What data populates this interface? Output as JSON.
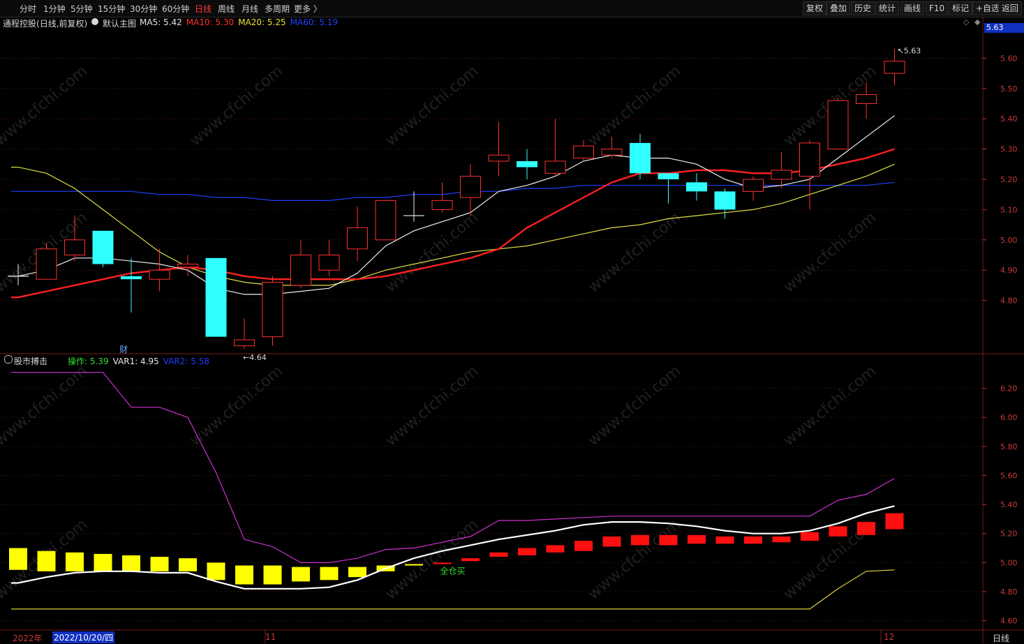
{
  "toolbar": {
    "periods": [
      "分时",
      "1分钟",
      "5分钟",
      "15分钟",
      "30分钟",
      "60分钟",
      "日线",
      "周线",
      "月线",
      "多周期",
      "更多 〉"
    ],
    "active_period": "日线",
    "buttons": [
      "复权",
      "叠加",
      "历史",
      "统计",
      "画线",
      "F10",
      "标记",
      "+自选",
      "返回"
    ]
  },
  "main_panel": {
    "stock_name": "通程控股",
    "mode": "(日线,前复权)",
    "template": "默认主图",
    "ma": [
      {
        "label": "MA5: 5.42",
        "color": "#e8e8e8"
      },
      {
        "label": "MA10: 5.30",
        "color": "#ff3030"
      },
      {
        "label": "MA20: 5.25",
        "color": "#f0e040"
      },
      {
        "label": "MA60: 5.19",
        "color": "#2040ff"
      }
    ],
    "price_box": "5.63",
    "max_label": "5.63",
    "min_label": "4.64",
    "finance_marker": "财",
    "y_ticks": [
      "5.60",
      "5.50",
      "5.40",
      "5.30",
      "5.20",
      "5.10",
      "5.00",
      "4.90",
      "4.80"
    ]
  },
  "sub_panel": {
    "name": "股市搏击",
    "ind": [
      {
        "label": "操作: 5.39",
        "color": "#30e030"
      },
      {
        "label": "VAR1: 4.95",
        "color": "#e8e8e8"
      },
      {
        "label": "VAR2: 5.58",
        "color": "#2040ff"
      }
    ],
    "signal_label": "全仓买",
    "y_ticks": [
      "6.20",
      "6.00",
      "5.80",
      "5.60",
      "5.40",
      "5.20",
      "5.00",
      "4.80",
      "4.60"
    ]
  },
  "bottom_axis": {
    "labels": [
      "2022年",
      "2022/10/20/四",
      "11",
      "12"
    ],
    "period_label": "日线"
  },
  "watermark": "www.cfchi.com",
  "chart_data": {
    "type": "candlestick",
    "main": {
      "candles": [
        {
          "o": 4.88,
          "h": 4.92,
          "l": 4.85,
          "c": 4.88
        },
        {
          "o": 4.87,
          "h": 4.99,
          "l": 4.87,
          "c": 4.97
        },
        {
          "o": 4.95,
          "h": 5.08,
          "l": 4.93,
          "c": 5.0
        },
        {
          "o": 5.03,
          "h": 5.03,
          "l": 4.91,
          "c": 4.92
        },
        {
          "o": 4.88,
          "h": 4.94,
          "l": 4.76,
          "c": 4.87
        },
        {
          "o": 4.87,
          "h": 4.97,
          "l": 4.83,
          "c": 4.9
        },
        {
          "o": 4.91,
          "h": 4.95,
          "l": 4.88,
          "c": 4.92
        },
        {
          "o": 4.94,
          "h": 4.94,
          "l": 4.68,
          "c": 4.68
        },
        {
          "o": 4.65,
          "h": 4.74,
          "l": 4.64,
          "c": 4.67
        },
        {
          "o": 4.68,
          "h": 4.88,
          "l": 4.65,
          "c": 4.86
        },
        {
          "o": 4.85,
          "h": 5.0,
          "l": 4.84,
          "c": 4.95
        },
        {
          "o": 4.9,
          "h": 5.0,
          "l": 4.88,
          "c": 4.95
        },
        {
          "o": 4.97,
          "h": 5.11,
          "l": 4.93,
          "c": 5.04
        },
        {
          "o": 5.0,
          "h": 5.13,
          "l": 5.0,
          "c": 5.13
        },
        {
          "o": 5.08,
          "h": 5.16,
          "l": 5.06,
          "c": 5.08
        },
        {
          "o": 5.1,
          "h": 5.19,
          "l": 5.09,
          "c": 5.13
        },
        {
          "o": 5.14,
          "h": 5.25,
          "l": 5.08,
          "c": 5.21
        },
        {
          "o": 5.26,
          "h": 5.39,
          "l": 5.21,
          "c": 5.28
        },
        {
          "o": 5.26,
          "h": 5.3,
          "l": 5.2,
          "c": 5.24
        },
        {
          "o": 5.22,
          "h": 5.4,
          "l": 5.21,
          "c": 5.26
        },
        {
          "o": 5.27,
          "h": 5.33,
          "l": 5.26,
          "c": 5.31
        },
        {
          "o": 5.28,
          "h": 5.34,
          "l": 5.27,
          "c": 5.3
        },
        {
          "o": 5.32,
          "h": 5.35,
          "l": 5.2,
          "c": 5.22
        },
        {
          "o": 5.22,
          "h": 5.22,
          "l": 5.12,
          "c": 5.2
        },
        {
          "o": 5.19,
          "h": 5.22,
          "l": 5.13,
          "c": 5.16
        },
        {
          "o": 5.16,
          "h": 5.17,
          "l": 5.07,
          "c": 5.1
        },
        {
          "o": 5.16,
          "h": 5.21,
          "l": 5.13,
          "c": 5.2
        },
        {
          "o": 5.2,
          "h": 5.29,
          "l": 5.17,
          "c": 5.23
        },
        {
          "o": 5.21,
          "h": 5.33,
          "l": 5.1,
          "c": 5.32
        },
        {
          "o": 5.3,
          "h": 5.47,
          "l": 5.3,
          "c": 5.46
        },
        {
          "o": 5.45,
          "h": 5.52,
          "l": 5.4,
          "c": 5.48
        },
        {
          "o": 5.55,
          "h": 5.63,
          "l": 5.51,
          "c": 5.59
        }
      ],
      "ma5": [
        4.88,
        4.9,
        4.94,
        4.94,
        4.93,
        4.92,
        4.9,
        4.84,
        4.82,
        4.82,
        4.83,
        4.84,
        4.89,
        4.98,
        5.03,
        5.06,
        5.09,
        5.16,
        5.18,
        5.21,
        5.26,
        5.28,
        5.27,
        5.27,
        5.25,
        5.2,
        5.17,
        5.18,
        5.2,
        5.27,
        5.34,
        5.41
      ],
      "ma10": [
        4.81,
        4.83,
        4.85,
        4.87,
        4.89,
        4.9,
        4.91,
        4.9,
        4.88,
        4.87,
        4.87,
        4.87,
        4.87,
        4.88,
        4.9,
        4.92,
        4.94,
        4.97,
        5.04,
        5.09,
        5.14,
        5.19,
        5.22,
        5.22,
        5.23,
        5.23,
        5.22,
        5.22,
        5.23,
        5.25,
        5.27,
        5.3
      ],
      "ma20": [
        5.24,
        5.22,
        5.17,
        5.1,
        5.03,
        4.96,
        4.91,
        4.88,
        4.86,
        4.85,
        4.85,
        4.85,
        4.87,
        4.9,
        4.92,
        4.94,
        4.96,
        4.97,
        4.98,
        5.0,
        5.02,
        5.04,
        5.05,
        5.07,
        5.08,
        5.09,
        5.1,
        5.12,
        5.15,
        5.18,
        5.21,
        5.25
      ],
      "ma60": [
        5.16,
        5.16,
        5.16,
        5.16,
        5.16,
        5.15,
        5.15,
        5.14,
        5.14,
        5.13,
        5.13,
        5.13,
        5.14,
        5.14,
        5.15,
        5.15,
        5.16,
        5.16,
        5.17,
        5.17,
        5.18,
        5.18,
        5.18,
        5.18,
        5.18,
        5.18,
        5.18,
        5.18,
        5.18,
        5.18,
        5.18,
        5.19
      ]
    },
    "sub": {
      "bars": [
        {
          "top": 5.1,
          "bot": 4.95
        },
        {
          "top": 5.08,
          "bot": 4.94
        },
        {
          "top": 5.07,
          "bot": 4.94
        },
        {
          "top": 5.06,
          "bot": 4.94
        },
        {
          "top": 5.05,
          "bot": 4.94
        },
        {
          "top": 5.04,
          "bot": 4.94
        },
        {
          "top": 5.03,
          "bot": 4.94
        },
        {
          "top": 5.0,
          "bot": 4.88
        },
        {
          "top": 4.98,
          "bot": 4.85
        },
        {
          "top": 4.98,
          "bot": 4.85
        },
        {
          "top": 4.97,
          "bot": 4.87
        },
        {
          "top": 4.97,
          "bot": 4.88
        },
        {
          "top": 4.97,
          "bot": 4.9
        },
        {
          "top": 4.98,
          "bot": 4.94
        },
        {
          "top": 4.99,
          "bot": 4.98
        },
        {
          "top": 5.0,
          "bot": 4.99
        },
        {
          "top": 5.03,
          "bot": 5.01
        },
        {
          "top": 5.07,
          "bot": 5.04
        },
        {
          "top": 5.1,
          "bot": 5.05
        },
        {
          "top": 5.12,
          "bot": 5.07
        },
        {
          "top": 5.15,
          "bot": 5.08
        },
        {
          "top": 5.18,
          "bot": 5.11
        },
        {
          "top": 5.19,
          "bot": 5.12
        },
        {
          "top": 5.19,
          "bot": 5.12
        },
        {
          "top": 5.19,
          "bot": 5.13
        },
        {
          "top": 5.18,
          "bot": 5.13
        },
        {
          "top": 5.18,
          "bot": 5.13
        },
        {
          "top": 5.18,
          "bot": 5.14
        },
        {
          "top": 5.21,
          "bot": 5.15
        },
        {
          "top": 5.25,
          "bot": 5.18
        },
        {
          "top": 5.28,
          "bot": 5.19
        },
        {
          "top": 5.34,
          "bot": 5.23
        }
      ],
      "bar_colors": [
        "Y",
        "Y",
        "Y",
        "Y",
        "Y",
        "Y",
        "Y",
        "Y",
        "Y",
        "Y",
        "Y",
        "Y",
        "Y",
        "Y",
        "Y",
        "R",
        "R",
        "R",
        "R",
        "R",
        "R",
        "R",
        "R",
        "R",
        "R",
        "R",
        "R",
        "R",
        "R",
        "R",
        "R",
        "R"
      ],
      "white": [
        4.86,
        4.9,
        4.93,
        4.94,
        4.94,
        4.93,
        4.93,
        4.87,
        4.82,
        4.82,
        4.82,
        4.83,
        4.88,
        4.96,
        5.03,
        5.08,
        5.12,
        5.16,
        5.19,
        5.22,
        5.26,
        5.28,
        5.28,
        5.27,
        5.25,
        5.22,
        5.2,
        5.2,
        5.22,
        5.27,
        5.34,
        5.39
      ],
      "magenta": [
        6.31,
        6.31,
        6.31,
        6.31,
        6.07,
        6.07,
        6.0,
        5.62,
        5.16,
        5.11,
        5.0,
        5.0,
        5.03,
        5.09,
        5.1,
        5.14,
        5.18,
        5.29,
        5.29,
        5.3,
        5.31,
        5.32,
        5.32,
        5.32,
        5.32,
        5.32,
        5.32,
        5.32,
        5.32,
        5.43,
        5.47,
        5.58
      ],
      "yellow_line": [
        4.68,
        4.68,
        4.68,
        4.68,
        4.68,
        4.68,
        4.68,
        4.68,
        4.68,
        4.68,
        4.68,
        4.68,
        4.68,
        4.68,
        4.68,
        4.68,
        4.68,
        4.68,
        4.68,
        4.68,
        4.68,
        4.68,
        4.68,
        4.68,
        4.68,
        4.68,
        4.68,
        4.68,
        4.68,
        4.82,
        4.94,
        4.95
      ],
      "signal_index": 15
    },
    "main_range": [
      4.64,
      5.7
    ],
    "sub_range": [
      4.55,
      6.4
    ]
  }
}
